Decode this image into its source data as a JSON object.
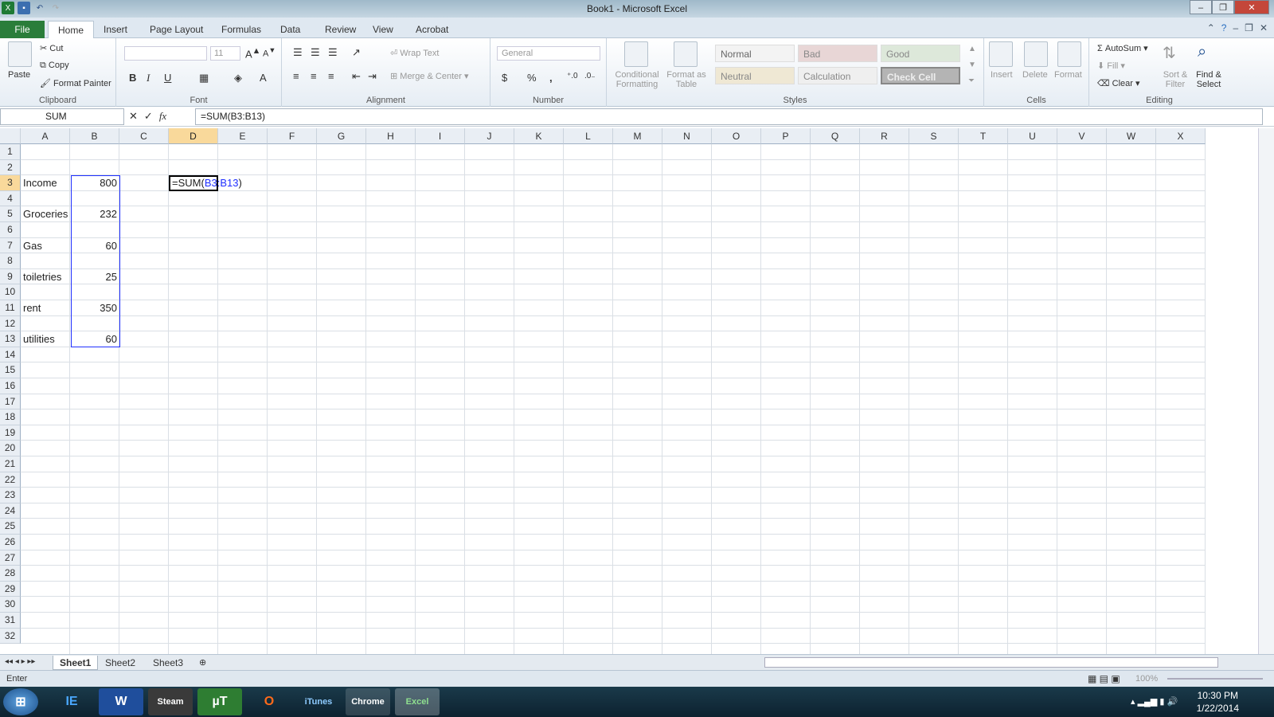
{
  "window": {
    "title": "Book1 - Microsoft Excel",
    "controls": [
      "–",
      "❐",
      "✕"
    ]
  },
  "tabs": [
    "File",
    "Home",
    "Insert",
    "Page Layout",
    "Formulas",
    "Data",
    "Review",
    "View",
    "Acrobat"
  ],
  "ribbon": {
    "clipboard": {
      "label": "Clipboard",
      "paste": "Paste",
      "cut": "Cut",
      "copy": "Copy",
      "format_painter": "Format Painter"
    },
    "font": {
      "label": "Font",
      "size": "11",
      "bold": "B",
      "italic": "I",
      "underline": "U"
    },
    "alignment": {
      "label": "Alignment",
      "wrap": "Wrap Text",
      "merge": "Merge & Center"
    },
    "number": {
      "label": "Number",
      "format": "General",
      "currency": "$",
      "percent": "%",
      "comma": ","
    },
    "styles": {
      "label": "Styles",
      "conditional": "Conditional Formatting",
      "format_table": "Format as Table",
      "normal": "Normal",
      "bad": "Bad",
      "good": "Good",
      "neutral": "Neutral",
      "calculation": "Calculation",
      "check_cell": "Check Cell"
    },
    "cells": {
      "label": "Cells",
      "insert": "Insert",
      "delete": "Delete",
      "format": "Format"
    },
    "editing": {
      "label": "Editing",
      "autosum": "AutoSum",
      "fill": "Fill",
      "clear": "Clear",
      "sort": "Sort & Filter",
      "find": "Find & Select"
    }
  },
  "formula_bar": {
    "name_box": "SUM",
    "formula": "=SUM(B3:B13)",
    "fx": "fx"
  },
  "columns": [
    "A",
    "B",
    "C",
    "D",
    "E",
    "F",
    "G",
    "H",
    "I",
    "J",
    "K",
    "L",
    "M",
    "N",
    "O",
    "P",
    "Q",
    "R",
    "S",
    "T",
    "U",
    "V",
    "W",
    "X"
  ],
  "rows": [
    "1",
    "2",
    "3",
    "4",
    "5",
    "6",
    "7",
    "8",
    "9",
    "10",
    "11",
    "12",
    "13",
    "14",
    "15",
    "16",
    "17",
    "18",
    "19",
    "20",
    "21",
    "22",
    "23",
    "24",
    "25",
    "26",
    "27",
    "28",
    "29",
    "30",
    "31",
    "32"
  ],
  "cells": [
    {
      "row": 3,
      "col": "A",
      "value": "Income"
    },
    {
      "row": 3,
      "col": "B",
      "value": "800"
    },
    {
      "row": 5,
      "col": "A",
      "value": "Groceries"
    },
    {
      "row": 5,
      "col": "B",
      "value": "232"
    },
    {
      "row": 7,
      "col": "A",
      "value": "Gas"
    },
    {
      "row": 7,
      "col": "B",
      "value": "60"
    },
    {
      "row": 9,
      "col": "A",
      "value": "toiletries"
    },
    {
      "row": 9,
      "col": "B",
      "value": "25"
    },
    {
      "row": 11,
      "col": "A",
      "value": "rent"
    },
    {
      "row": 11,
      "col": "B",
      "value": "350"
    },
    {
      "row": 13,
      "col": "A",
      "value": "utilities"
    },
    {
      "row": 13,
      "col": "B",
      "value": "60"
    }
  ],
  "edit_cell": {
    "prefix": "=SUM(",
    "ref": "B3:B13",
    "suffix": ")"
  },
  "sheets": [
    "Sheet1",
    "Sheet2",
    "Sheet3"
  ],
  "status": {
    "mode": "Enter",
    "zoom": "100%"
  },
  "taskbar": {
    "apps": [
      "IE",
      "W",
      "Steam",
      "µT",
      "O",
      "iTunes",
      "Chrome",
      "Excel"
    ],
    "time": "10:30 PM",
    "date": "1/22/2014"
  }
}
